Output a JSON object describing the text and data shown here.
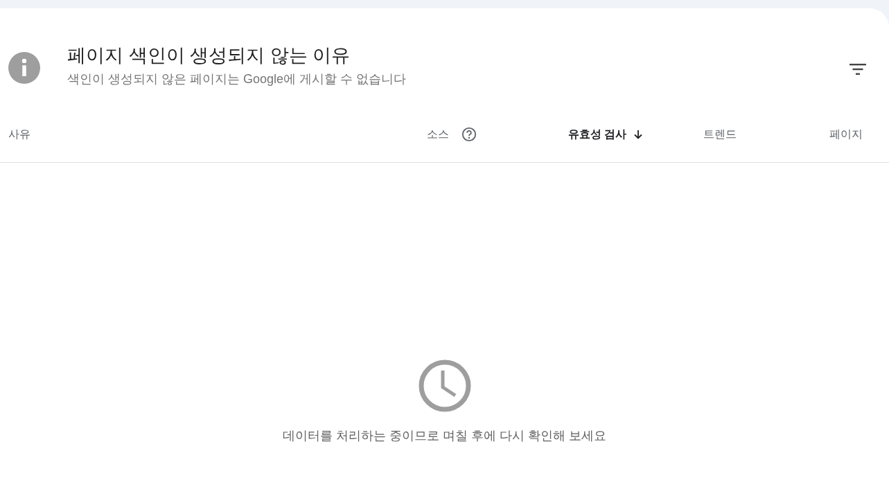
{
  "header": {
    "title": "페이지 색인이 생성되지 않는 이유",
    "subtitle": "색인이 생성되지 않은 페이지는 Google에 게시할 수 없습니다"
  },
  "table": {
    "columns": [
      {
        "label": "사유",
        "help": false,
        "sorted": false
      },
      {
        "label": "소스",
        "help": true,
        "sorted": false
      },
      {
        "label": "유효성 검사",
        "help": false,
        "sorted": true
      },
      {
        "label": "트렌드",
        "help": false,
        "sorted": false
      },
      {
        "label": "페이지",
        "help": false,
        "sorted": false
      }
    ]
  },
  "empty_state": {
    "message": "데이터를 처리하는 중이므로 며칠 후에 다시 확인해 보세요"
  }
}
